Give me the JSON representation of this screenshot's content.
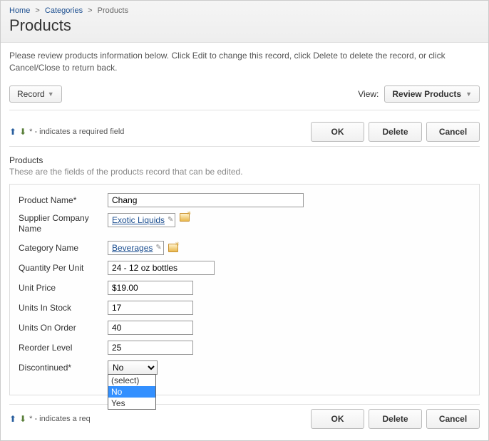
{
  "breadcrumb": {
    "home": "Home",
    "categories": "Categories",
    "current": "Products"
  },
  "page_title": "Products",
  "description": "Please review products information below. Click Edit to change this record, click Delete to delete the record, or click Cancel/Close to return back.",
  "toolbar": {
    "record_label": "Record",
    "view_label": "View:",
    "view_value": "Review Products"
  },
  "indicators_text": "* - indicates a required field",
  "indicators_text_cut": "* - indicates a req",
  "buttons": {
    "ok": "OK",
    "delete": "Delete",
    "cancel": "Cancel"
  },
  "section": {
    "title": "Products",
    "desc": "These are the fields of the products record that can be edited."
  },
  "form": {
    "product_name": {
      "label": "Product Name*",
      "value": "Chang"
    },
    "supplier": {
      "label": "Supplier Company Name",
      "value": "Exotic Liquids"
    },
    "category": {
      "label": "Category Name",
      "value": "Beverages"
    },
    "qty_per_unit": {
      "label": "Quantity Per Unit",
      "value": "24 - 12 oz bottles"
    },
    "unit_price": {
      "label": "Unit Price",
      "value": "$19.00"
    },
    "units_in_stock": {
      "label": "Units In Stock",
      "value": "17"
    },
    "units_on_order": {
      "label": "Units On Order",
      "value": "40"
    },
    "reorder_level": {
      "label": "Reorder Level",
      "value": "25"
    },
    "discontinued": {
      "label": "Discontinued*",
      "value": "No",
      "options": {
        "placeholder": "(select)",
        "no": "No",
        "yes": "Yes"
      }
    }
  }
}
